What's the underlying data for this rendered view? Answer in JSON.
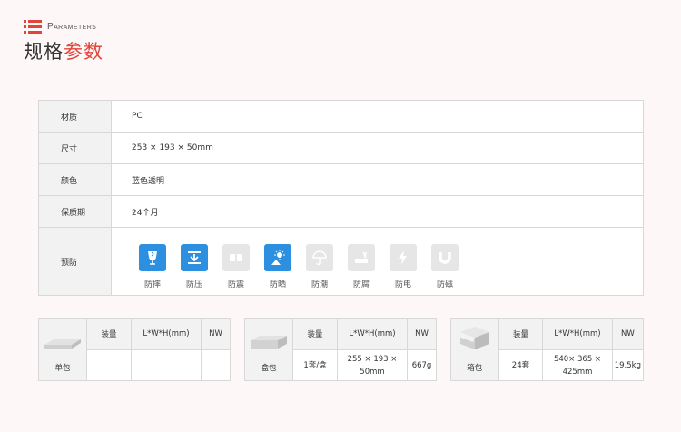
{
  "header": {
    "en": "Parameters",
    "cn_part1": "规格",
    "cn_part2": "参数"
  },
  "spec": [
    {
      "key": "材质",
      "value": "PC"
    },
    {
      "key": "尺寸",
      "value": "253 × 193 × 50mm"
    },
    {
      "key": "颜色",
      "value": "蓝色透明"
    },
    {
      "key": "保质期",
      "value": "24个月"
    }
  ],
  "protect": {
    "key": "预防",
    "items": [
      {
        "label": "防摔",
        "icon": "fragile-glass-icon",
        "active": true
      },
      {
        "label": "防压",
        "icon": "pressure-icon",
        "active": true
      },
      {
        "label": "防震",
        "icon": "shock-icon",
        "active": false
      },
      {
        "label": "防晒",
        "icon": "sun-icon",
        "active": true
      },
      {
        "label": "防潮",
        "icon": "umbrella-icon",
        "active": false
      },
      {
        "label": "防腐",
        "icon": "corrosion-icon",
        "active": false
      },
      {
        "label": "防电",
        "icon": "lightning-icon",
        "active": false
      },
      {
        "label": "防磁",
        "icon": "magnet-icon",
        "active": false
      }
    ]
  },
  "packaging": {
    "headers": {
      "qty": "装量",
      "dims": "L*W*H(mm)",
      "nw": "NW"
    },
    "items": [
      {
        "name": "单包",
        "qty": "",
        "dims": "",
        "nw": ""
      },
      {
        "name": "盒包",
        "qty": "1套/盒",
        "dims": "255 × 193 × 50mm",
        "nw": "667g"
      },
      {
        "name": "箱包",
        "qty": "24套",
        "dims": "540× 365 × 425mm",
        "nw": "19.5kg"
      }
    ]
  },
  "colors": {
    "accent": "#e1453a",
    "active_icon": "#2d8fe0",
    "inactive_icon": "#e6e6e6"
  }
}
